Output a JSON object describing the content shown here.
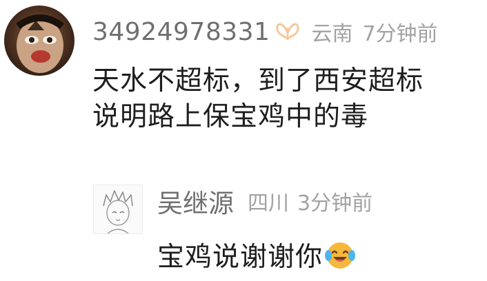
{
  "main_comment": {
    "avatar_icon": "user-avatar-clown-face",
    "username": "34924978331",
    "badge_icon": "butterfly-badge-icon",
    "badge_color": "#f6c79b",
    "location": "云南",
    "time": "7分钟前",
    "text_lines": [
      "天水不超标，到了西安超标",
      "说明路上保宝鸡中的毒"
    ]
  },
  "reply": {
    "avatar_icon": "user-avatar-anime-sketch",
    "username": "吴继源",
    "location": "四川",
    "time": "3分钟前",
    "text": "宝鸡说谢谢你",
    "emoji_icon": "laughing-tears-emoji"
  }
}
